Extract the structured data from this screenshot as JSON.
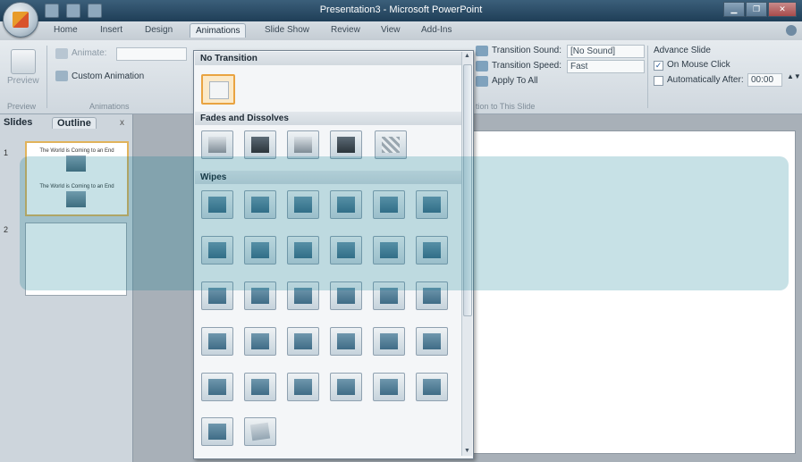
{
  "window": {
    "title": "Presentation3 - Microsoft PowerPoint",
    "buttons": [
      "▁",
      "❐",
      "✕"
    ]
  },
  "ribbon_tabs": [
    "Home",
    "Insert",
    "Design",
    "Animations",
    "Slide Show",
    "Review",
    "View",
    "Add-Ins"
  ],
  "active_tab": "Animations",
  "ribbon": {
    "preview_label": "Preview",
    "preview_group": "Preview",
    "animate_label": "Animate:",
    "custom_animation": "Custom Animation",
    "animations_group": "Animations",
    "transition_sound_label": "Transition Sound:",
    "transition_sound_value": "[No Sound]",
    "transition_speed_label": "Transition Speed:",
    "transition_speed_value": "Fast",
    "apply_to_all": "Apply To All",
    "transition_group": "tion to This Slide",
    "advance_slide": "Advance Slide",
    "on_mouse_click": "On Mouse Click",
    "on_mouse_click_checked": true,
    "automatically_after": "Automatically After:",
    "automatically_after_value": "00:00"
  },
  "left_panel": {
    "tab_slides": "Slides",
    "tab_outline": "Outline",
    "close": "x",
    "slides": [
      {
        "num": "1",
        "title1": "The World is Coming to an End",
        "title2": "The World is Coming to an End"
      },
      {
        "num": "2"
      }
    ]
  },
  "gallery": {
    "sections": [
      {
        "title": "No Transition",
        "tiles": 1
      },
      {
        "title": "Fades and Dissolves",
        "tiles": 5
      },
      {
        "title": "Wipes",
        "tiles": 6
      }
    ],
    "icons": {
      "scroll_up": "▲",
      "scroll_down": "▼"
    }
  }
}
